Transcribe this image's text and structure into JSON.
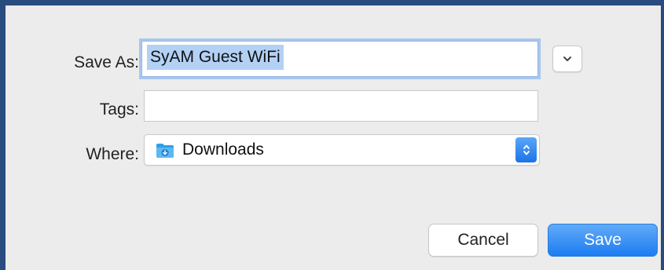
{
  "dialog": {
    "save_as_label": "Save As:",
    "save_as_value": "SyAM Guest WiFi",
    "tags_label": "Tags:",
    "tags_value": "",
    "where_label": "Where:",
    "where_value": "Downloads",
    "cancel_label": "Cancel",
    "save_label": "Save"
  },
  "icons": {
    "expand": "chevron-down-icon",
    "folder": "downloads-folder-icon",
    "stepper": "up-down-arrows-icon"
  },
  "colors": {
    "accent": "#1c7cf2",
    "selection": "#b3d1f5",
    "window_border": "#2a4b7f"
  }
}
